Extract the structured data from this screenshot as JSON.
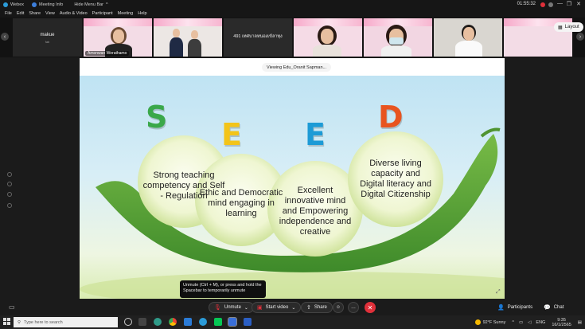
{
  "titlebar": {
    "app_name": "Webex",
    "meeting_info": "Meeting Info",
    "hide_menu": "Hide Menu Bar",
    "hide_menu_chevron": "^",
    "clock": "01:55:32"
  },
  "window_controls": {
    "minimize": "—",
    "restore": "❐",
    "close": "✕",
    "extra": "⋯"
  },
  "menu": [
    "File",
    "Edit",
    "Share",
    "View",
    "Audio & Video",
    "Participant",
    "Meeting",
    "Help"
  ],
  "participants": {
    "first_name": "makue",
    "first_sub": "fab",
    "tile2_name": "Amonwan Werathamo",
    "tile4_label": "491 เทศบาลหนองเข้ลาทุง",
    "prev_arrow": "‹",
    "next_arrow": "›",
    "layout_label": "Layout"
  },
  "viewing_label": "Viewing Edu_Oranit Sapman...",
  "slide": {
    "letters": [
      "S",
      "E",
      "E",
      "D"
    ],
    "letter_colors": [
      "#3aa84a",
      "#f3c41a",
      "#1d9bd6",
      "#e8541f"
    ],
    "bubbles": [
      "Strong teaching competency and Self - Regulation",
      "Ethic and Democratic mind engaging in learning",
      "Excellent innovative mind and Empowering independence and creative",
      "Diverse living capacity and Digital literacy and Digital Citizenship"
    ]
  },
  "tooltip": "Unmute (Ctrl + M), or press and hold the Spacebar to temporarily unmute",
  "controls": {
    "unmute": "Unmute",
    "start_video": "Start video",
    "share": "Share",
    "more": "…",
    "end": "✕",
    "participants": "Participants",
    "chat": "Chat"
  },
  "taskbar": {
    "search_placeholder": "Type here to search",
    "weather": "92°F Sunny",
    "lang": "ENG",
    "time": "9:35",
    "date": "16/1/2565"
  },
  "colors": {
    "accent_red": "#e0303a",
    "bg": "#1b1b1b",
    "pea_green": "#5fa83a"
  }
}
